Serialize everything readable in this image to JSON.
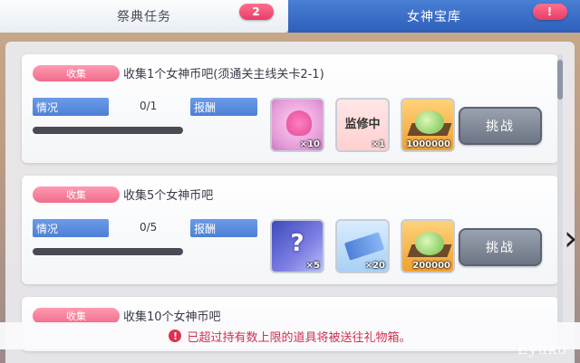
{
  "tabs": [
    {
      "label": "祭典任务",
      "badge": "2"
    },
    {
      "label": "女神宝库",
      "badge": "!"
    }
  ],
  "labels": {
    "status": "情况",
    "reward": "报酬",
    "challenge": "挑战"
  },
  "missions": [
    {
      "tag": "收集",
      "title": "收集1个女神币吧(须通关主线关卡2-1)",
      "progress": "0/1",
      "progress_fraction": 0,
      "rewards": [
        {
          "icon": "pink-heart-item-icon",
          "count": "×10"
        },
        {
          "icon": "supervising-seal-icon",
          "stamp": "监修中",
          "count": "×1"
        },
        {
          "icon": "green-gem-pile-icon",
          "count": "1000000"
        }
      ]
    },
    {
      "tag": "收集",
      "title": "收集5个女神币吧",
      "progress": "0/5",
      "progress_fraction": 0,
      "rewards": [
        {
          "icon": "mystery-box-icon",
          "stamp": "?",
          "count": "×5"
        },
        {
          "icon": "blue-ticket-icon",
          "count": "×20"
        },
        {
          "icon": "green-gem-pile-icon",
          "count": "200000"
        }
      ]
    },
    {
      "tag": "收集",
      "title": "收集10个女神币吧"
    }
  ],
  "notice": {
    "icon": "!",
    "text": "已超过持有数上限的道具将被送往礼物箱。"
  },
  "watermark": "Eyuko",
  "colors": {
    "accent_blue": "#3a6fcf",
    "tag_pink": "#f06c8c",
    "notice_red": "#d03050"
  }
}
